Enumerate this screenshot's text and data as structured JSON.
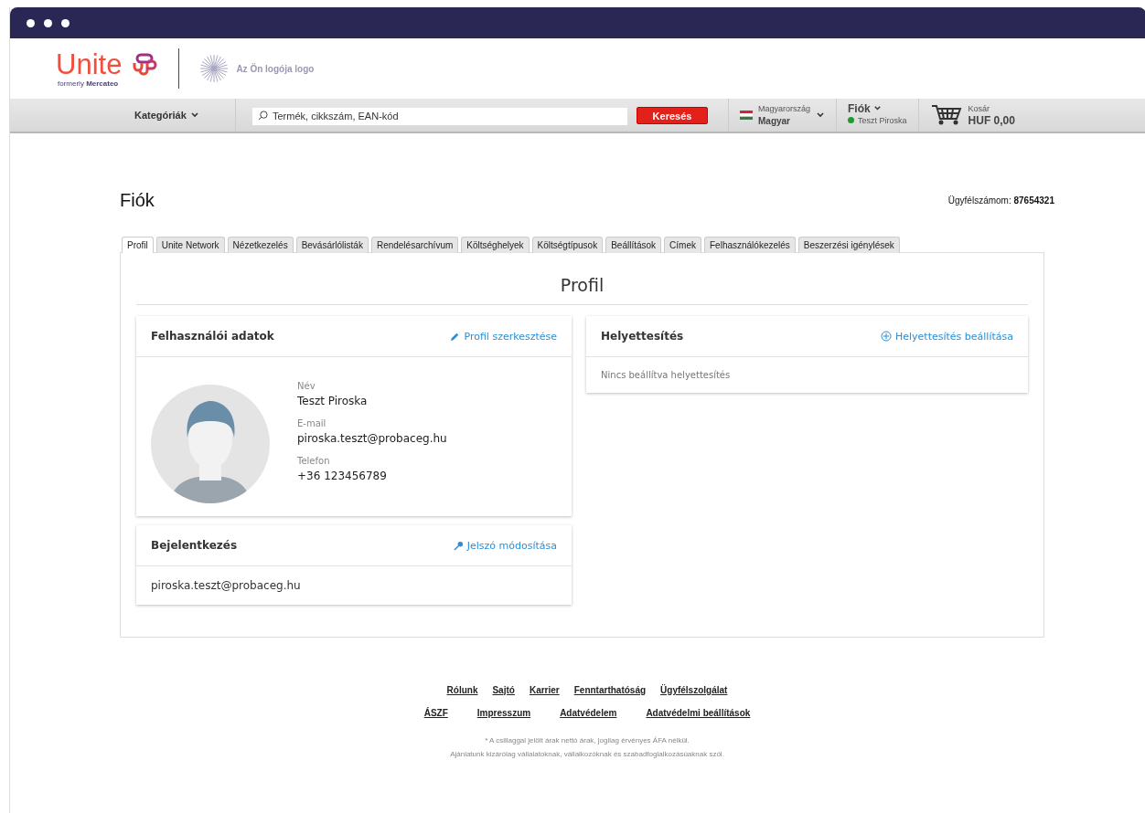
{
  "logo": {
    "brand": "Unite",
    "formerly": "formerly",
    "former_name": "Mercateo",
    "partner_logo": "Az Ön logója logo"
  },
  "navbar": {
    "categories": "Kategóriák",
    "search": {
      "placeholder": "Termék, cikkszám, EAN-kód"
    },
    "search_button": "Keresés",
    "country": "Magyarország",
    "language": "Magyar",
    "account": "Fiók",
    "user": "Teszt Piroska",
    "user_online": true,
    "cart_label": "Kosár",
    "cart_total": "HUF 0,00"
  },
  "page": {
    "title": "Fiók",
    "customer_label": "Ügyfélszámom:",
    "customer_number": "87654321"
  },
  "tabs": [
    {
      "label": "Profil",
      "selected": true
    },
    {
      "label": "Unite Network",
      "selected": false
    },
    {
      "label": "Nézetkezelés",
      "selected": false
    },
    {
      "label": "Bevásárlólisták",
      "selected": false
    },
    {
      "label": "Rendelésarchívum",
      "selected": false
    },
    {
      "label": "Költséghelyek",
      "selected": false
    },
    {
      "label": "Költségtípusok",
      "selected": false
    },
    {
      "label": "Beállítások",
      "selected": false
    },
    {
      "label": "Címek",
      "selected": false
    },
    {
      "label": "Felhasználókezelés",
      "selected": false
    },
    {
      "label": "Beszerzési igénylések",
      "selected": false
    }
  ],
  "section_title": "Profil",
  "user_card": {
    "title": "Felhasználói adatok",
    "action": "Profil szerkesztése",
    "fields": [
      {
        "label": "Név",
        "value": "Teszt Piroska"
      },
      {
        "label": "E-mail",
        "value": "piroska.teszt@probaceg.hu"
      },
      {
        "label": "Telefon",
        "value": "+36 123456789"
      }
    ]
  },
  "login_card": {
    "title": "Bejelentkezés",
    "action": "Jelszó módosítása",
    "value": "piroska.teszt@probaceg.hu"
  },
  "substitution_card": {
    "title": "Helyettesítés",
    "action": "Helyettesítés beállítása",
    "empty": "Nincs beállítva helyettesítés"
  },
  "footer": {
    "links_row_1": [
      "Rólunk",
      "Sajtó",
      "Karrier",
      "Fenntarthatóság",
      "Ügyfélszolgálat"
    ],
    "links_row_2": [
      "ÁSZF",
      "Impresszum",
      "Adatvédelem",
      "Adatvédelmi beállítások"
    ],
    "notes": [
      "* A csillaggal jelölt árak nettó árak, jogilag érvényes ÁFA nélkül.",
      "Ajánlatunk kizárólag vállalatoknak, vállalkozóknak és szabadfoglalkozásúaknak szól."
    ]
  }
}
